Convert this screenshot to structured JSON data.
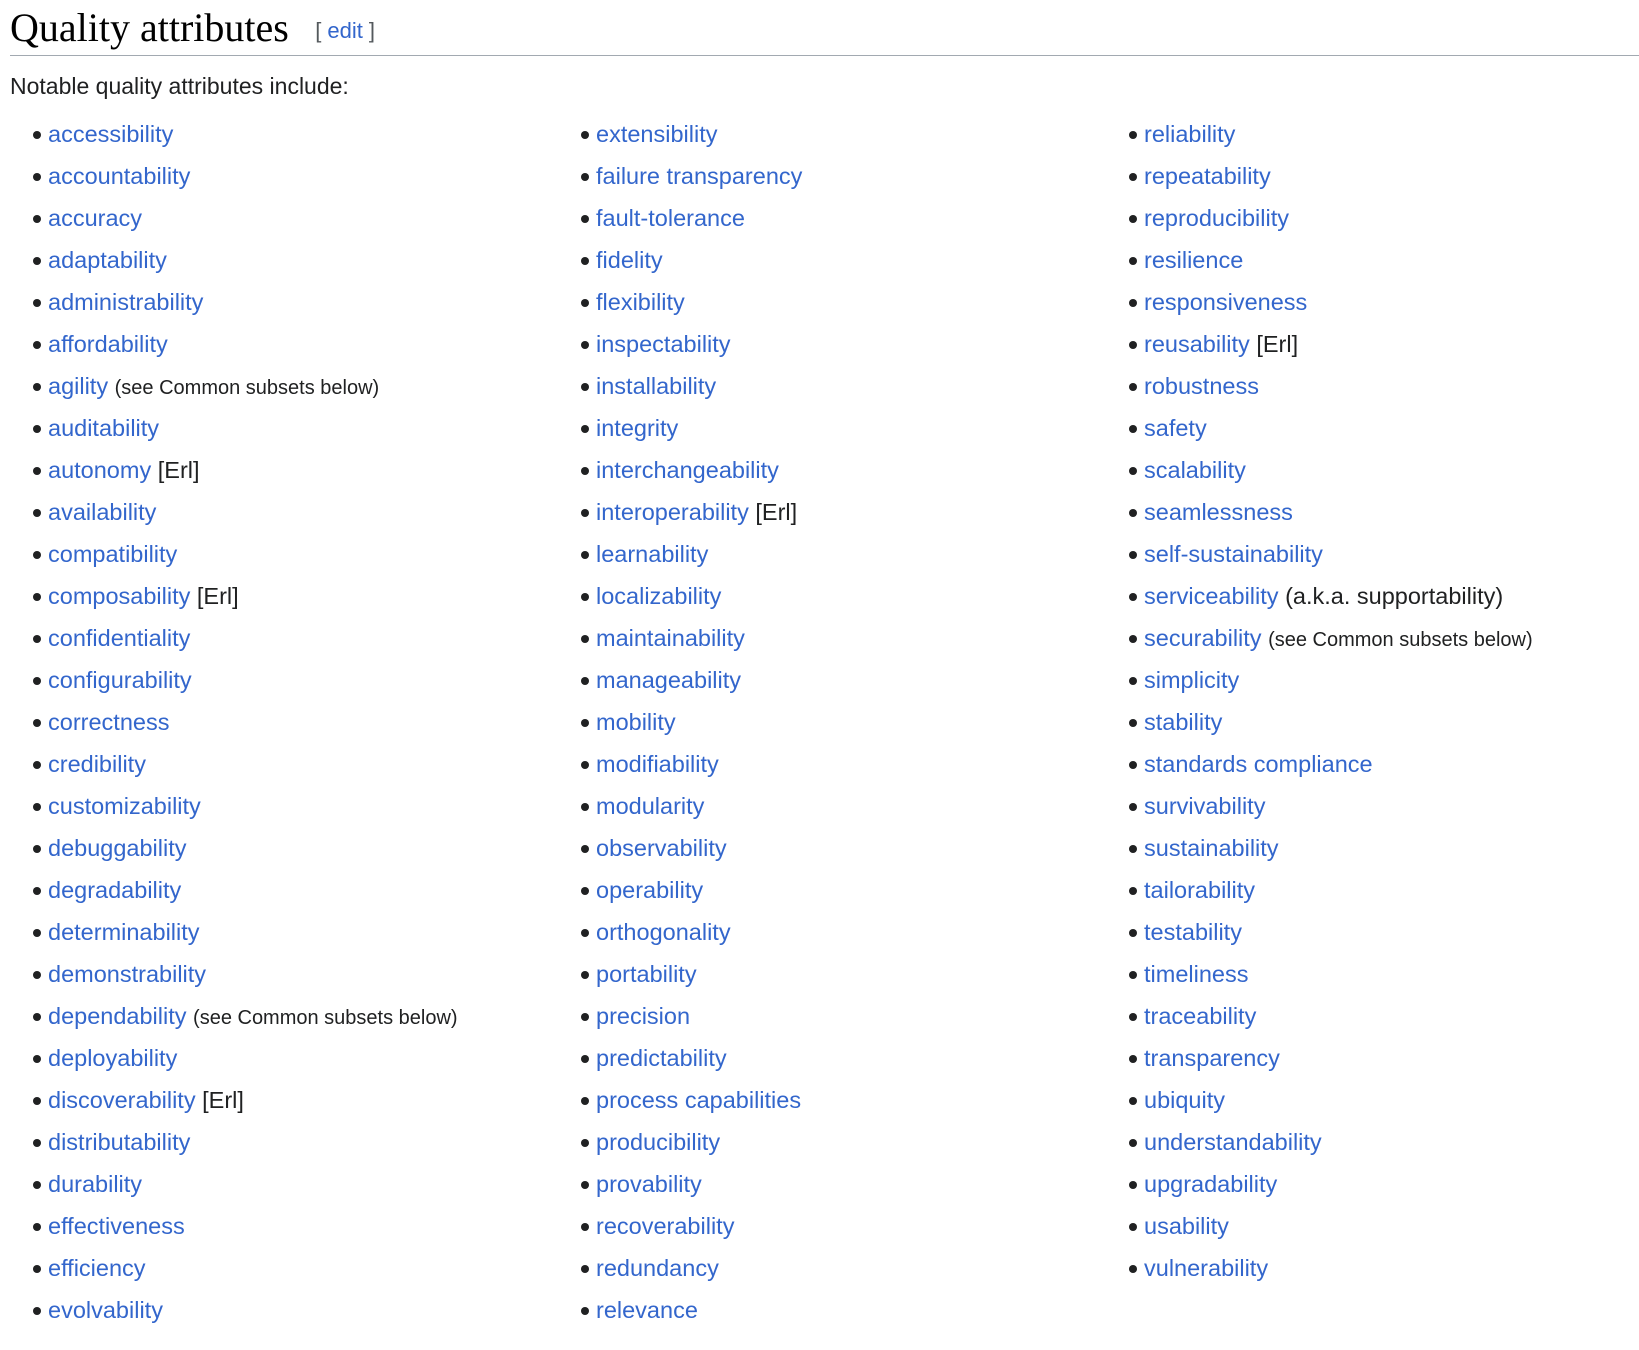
{
  "heading": {
    "title": "Quality attributes",
    "edit_open": "[",
    "edit_label": "edit",
    "edit_close": "]"
  },
  "intro": "Notable quality attributes include:",
  "columns": [
    [
      {
        "link": "accessibility",
        "note": ""
      },
      {
        "link": "accountability",
        "note": ""
      },
      {
        "link": "accuracy",
        "note": ""
      },
      {
        "link": "adaptability",
        "note": ""
      },
      {
        "link": "administrability",
        "note": ""
      },
      {
        "link": "affordability",
        "note": ""
      },
      {
        "link": "agility",
        "note": "(see Common subsets below)",
        "small": true
      },
      {
        "link": "auditability",
        "note": ""
      },
      {
        "link": "autonomy",
        "note": "[Erl]"
      },
      {
        "link": "availability",
        "note": ""
      },
      {
        "link": "compatibility",
        "note": ""
      },
      {
        "link": "composability",
        "note": "[Erl]"
      },
      {
        "link": "confidentiality",
        "note": ""
      },
      {
        "link": "configurability",
        "note": ""
      },
      {
        "link": "correctness",
        "note": ""
      },
      {
        "link": "credibility",
        "note": ""
      },
      {
        "link": "customizability",
        "note": ""
      },
      {
        "link": "debuggability",
        "note": ""
      },
      {
        "link": "degradability",
        "note": ""
      },
      {
        "link": "determinability",
        "note": ""
      },
      {
        "link": "demonstrability",
        "note": ""
      },
      {
        "link": "dependability",
        "note": "(see Common subsets below)",
        "small": true
      },
      {
        "link": "deployability",
        "note": ""
      },
      {
        "link": "discoverability",
        "note": "[Erl]"
      },
      {
        "link": "distributability",
        "note": ""
      },
      {
        "link": "durability",
        "note": ""
      },
      {
        "link": "effectiveness",
        "note": ""
      },
      {
        "link": "efficiency",
        "note": ""
      },
      {
        "link": "evolvability",
        "note": ""
      }
    ],
    [
      {
        "link": "extensibility",
        "note": ""
      },
      {
        "link": "failure transparency",
        "note": ""
      },
      {
        "link": "fault-tolerance",
        "note": ""
      },
      {
        "link": "fidelity",
        "note": ""
      },
      {
        "link": "flexibility",
        "note": ""
      },
      {
        "link": "inspectability",
        "note": ""
      },
      {
        "link": "installability",
        "note": ""
      },
      {
        "link": "integrity",
        "note": ""
      },
      {
        "link": "interchangeability",
        "note": ""
      },
      {
        "link": "interoperability",
        "note": "[Erl]"
      },
      {
        "link": "learnability",
        "note": ""
      },
      {
        "link": "localizability",
        "note": ""
      },
      {
        "link": "maintainability",
        "note": ""
      },
      {
        "link": "manageability",
        "note": ""
      },
      {
        "link": "mobility",
        "note": ""
      },
      {
        "link": "modifiability",
        "note": ""
      },
      {
        "link": "modularity",
        "note": ""
      },
      {
        "link": "observability",
        "note": ""
      },
      {
        "link": "operability",
        "note": ""
      },
      {
        "link": "orthogonality",
        "note": ""
      },
      {
        "link": "portability",
        "note": ""
      },
      {
        "link": "precision",
        "note": ""
      },
      {
        "link": "predictability",
        "note": ""
      },
      {
        "link": "process capabilities",
        "note": ""
      },
      {
        "link": "producibility",
        "note": ""
      },
      {
        "link": "provability",
        "note": ""
      },
      {
        "link": "recoverability",
        "note": ""
      },
      {
        "link": "redundancy",
        "note": ""
      },
      {
        "link": "relevance",
        "note": ""
      }
    ],
    [
      {
        "link": "reliability",
        "note": ""
      },
      {
        "link": "repeatability",
        "note": ""
      },
      {
        "link": "reproducibility",
        "note": ""
      },
      {
        "link": "resilience",
        "note": ""
      },
      {
        "link": "responsiveness",
        "note": ""
      },
      {
        "link": "reusability",
        "note": "[Erl]"
      },
      {
        "link": "robustness",
        "note": ""
      },
      {
        "link": "safety",
        "note": ""
      },
      {
        "link": "scalability",
        "note": ""
      },
      {
        "link": "seamlessness",
        "note": ""
      },
      {
        "link": "self-sustainability",
        "note": ""
      },
      {
        "link": "serviceability",
        "note": "(a.k.a. supportability)"
      },
      {
        "link": "securability",
        "note": "(see Common subsets below)",
        "small": true
      },
      {
        "link": "simplicity",
        "note": ""
      },
      {
        "link": "stability",
        "note": ""
      },
      {
        "link": "standards compliance",
        "note": ""
      },
      {
        "link": "survivability",
        "note": ""
      },
      {
        "link": "sustainability",
        "note": ""
      },
      {
        "link": "tailorability",
        "note": ""
      },
      {
        "link": "testability",
        "note": ""
      },
      {
        "link": "timeliness",
        "note": ""
      },
      {
        "link": "traceability",
        "note": ""
      },
      {
        "link": "transparency",
        "note": ""
      },
      {
        "link": "ubiquity",
        "note": ""
      },
      {
        "link": "understandability",
        "note": ""
      },
      {
        "link": "upgradability",
        "note": ""
      },
      {
        "link": "usability",
        "note": ""
      },
      {
        "link": "vulnerability",
        "note": ""
      }
    ]
  ],
  "colors": {
    "link": "#3366cc",
    "text": "#202122",
    "heading_rule": "#a2a9b1"
  }
}
